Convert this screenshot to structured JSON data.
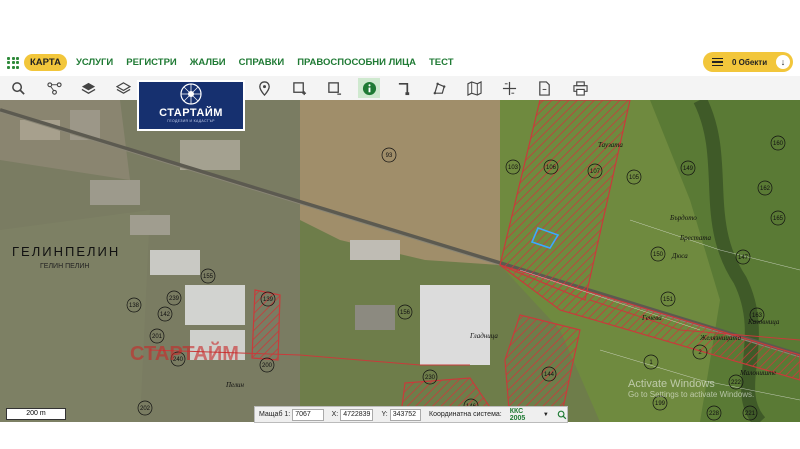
{
  "menu": {
    "items": [
      "КАРТА",
      "УСЛУГИ",
      "РЕГИСТРИ",
      "ЖАЛБИ",
      "СПРАВКИ",
      "ПРАВОСПОСОБНИ ЛИЦА",
      "ТЕСТ"
    ],
    "active_index": 0
  },
  "objects_button": {
    "label": "0 Обекти"
  },
  "logo": {
    "text": "СТАРТАЙМ",
    "subtitle": "ГЕОДЕЗИЯ И КАДАСТЪР"
  },
  "toolbar": {
    "tools": [
      "search-icon",
      "graph-icon",
      "layers-icon",
      "layers-outline-icon",
      "marker-icon",
      "select-rect-icon",
      "select-rect-minus-icon",
      "info-icon",
      "corner-icon",
      "polygon-icon",
      "map-icon",
      "crosshair-icon",
      "document-icon",
      "print-icon"
    ],
    "active_tool": "info-icon"
  },
  "map": {
    "place_label": "ГЕЛИНПЕЛИН",
    "place_sublabel": "ГЕЛИН ПЕЛИН",
    "watermark_logo": "СТАРТАЙМ",
    "parcels": [
      "93",
      "106",
      "103",
      "107",
      "105",
      "149",
      "160",
      "162",
      "165",
      "150",
      "147",
      "151",
      "163",
      "156",
      "138",
      "142",
      "139",
      "201",
      "200",
      "202",
      "146",
      "144",
      "228",
      "221",
      "222",
      "230",
      "199",
      "155",
      "2",
      "1",
      "239",
      "240"
    ],
    "toponyms": [
      "Таузата",
      "Бърдото",
      "Брестата",
      "Дюса",
      "Гечева",
      "Желязницата",
      "Казовница",
      "Гладница",
      "Малониште",
      "Пелин"
    ]
  },
  "scale": {
    "label": "200 m"
  },
  "coords": {
    "scale_label": "Мащаб 1:",
    "scale_value": "7067",
    "x_label": "X:",
    "x_value": "4722839",
    "y_label": "Y:",
    "y_value": "343752",
    "system_label": "Координатна система:",
    "system_value": "ККС 2005"
  },
  "watermark": {
    "title": "Activate Windows",
    "subtitle": "Go to Settings to activate Windows."
  },
  "colors": {
    "accent": "#1f7a34",
    "highlight": "#f2c63b",
    "parcel_red": "#c83b3b"
  }
}
